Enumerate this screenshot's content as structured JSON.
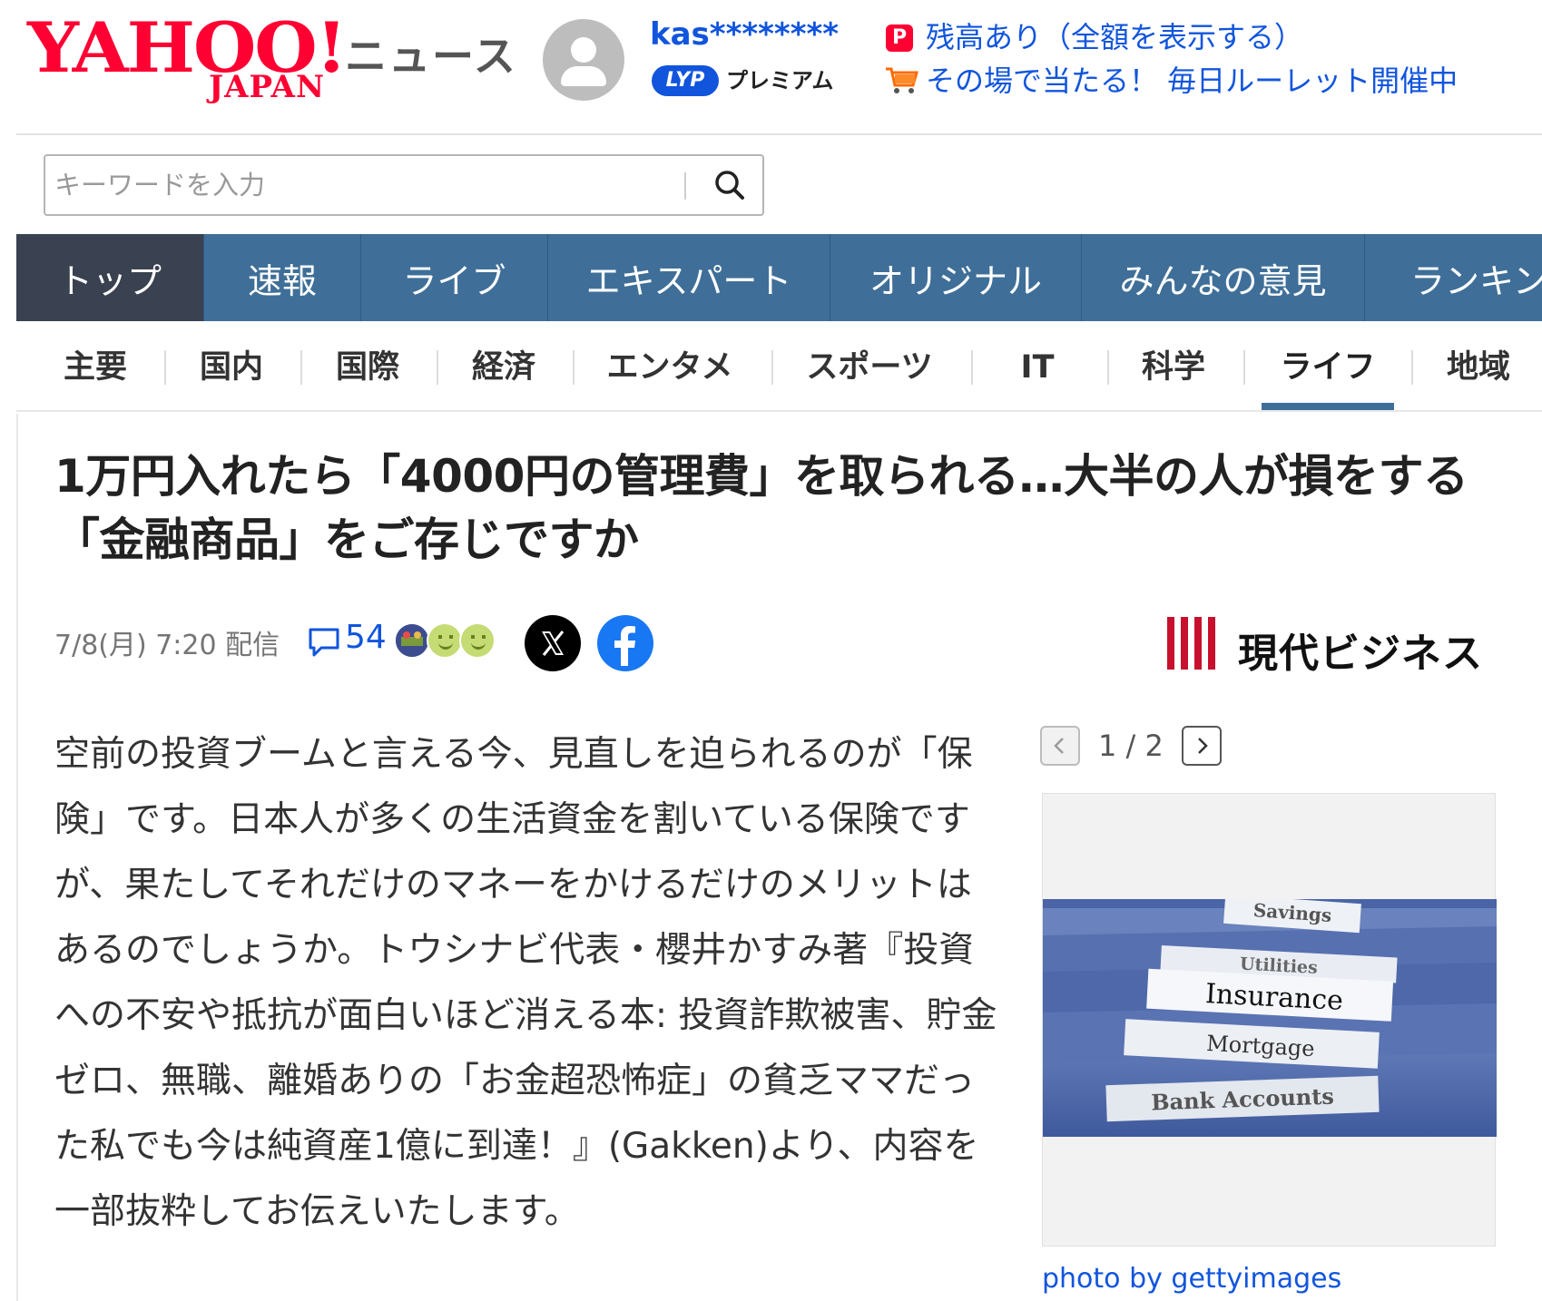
{
  "header": {
    "logo_main": "YAHOO!",
    "logo_sub": "JAPAN",
    "site_section": "ニュース",
    "user_name": "kas********",
    "lyp_badge": "LYP",
    "lyp_premium": "プレミアム",
    "pay_icon": "P",
    "balance_link": "残高あり（全額を表示する）",
    "roulette_link": "その場で当たる！ 毎日ルーレット開催中"
  },
  "search": {
    "placeholder": "キーワードを入力"
  },
  "main_nav": [
    {
      "label": "トップ",
      "active": true
    },
    {
      "label": "速報"
    },
    {
      "label": "ライブ"
    },
    {
      "label": "エキスパート"
    },
    {
      "label": "オリジナル"
    },
    {
      "label": "みんなの意見"
    },
    {
      "label": "ランキング"
    }
  ],
  "sub_nav": [
    {
      "label": "主要"
    },
    {
      "label": "国内"
    },
    {
      "label": "国際"
    },
    {
      "label": "経済"
    },
    {
      "label": "エンタメ"
    },
    {
      "label": "スポーツ"
    },
    {
      "label": "IT"
    },
    {
      "label": "科学"
    },
    {
      "label": "ライフ",
      "active": true
    },
    {
      "label": "地域"
    }
  ],
  "article": {
    "headline": "1万円入れたら「4000円の管理費」を取られる…大半の人が損をする「金融商品」をご存じですか",
    "date": "7/8(月) 7:20 配信",
    "comment_count": "54",
    "publisher": "現代ビジネス",
    "body": "空前の投資ブームと言える今、見直しを迫られるのが「保険」です。日本人が多くの生活資金を割いている保険ですが、果たしてそれだけのマネーをかけるだけのメリットはあるのでしょうか。トウシナビ代表・櫻井かすみ著『投資への不安や抵抗が面白いほど消える本: 投資詐欺被害、貯金ゼロ、無職、離婚ありの「お金超恐怖症」の貧乏ママだった私でも今は純資産1億に到達！』(Gakken)より、内容を一部抜粋してお伝えいたします。"
  },
  "photo": {
    "pager": "1 / 2",
    "tabs": [
      "Savings",
      "Utilities",
      "Insurance",
      "Mortgage",
      "Bank Accounts"
    ],
    "credit": "photo by gettyimages"
  },
  "colors": {
    "brand_red": "#ff0033",
    "link_blue": "#1155dd",
    "nav_blue": "#3f6f98",
    "nav_active": "#3a4150"
  }
}
